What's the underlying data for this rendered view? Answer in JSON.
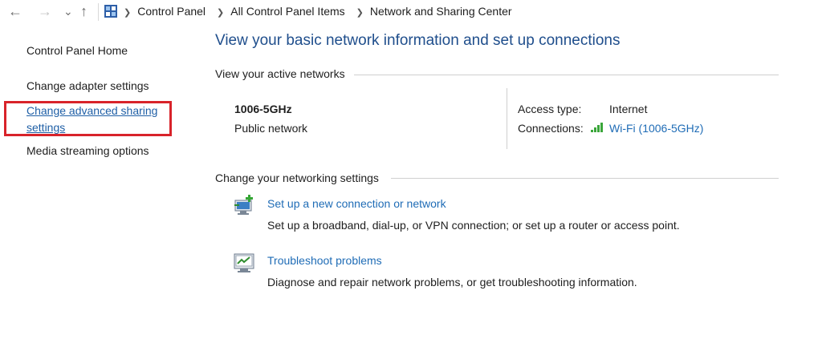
{
  "breadcrumb": [
    "Control Panel",
    "All Control Panel Items",
    "Network and Sharing Center"
  ],
  "nav": {
    "back": "←",
    "forward": "→",
    "recent": "⌄",
    "up": "↑"
  },
  "sidebar": {
    "home": "Control Panel Home",
    "items": [
      "Change adapter settings",
      "Change advanced sharing settings",
      "Media streaming options"
    ]
  },
  "main": {
    "title": "View your basic network information and set up connections",
    "active_networks_header": "View your active networks",
    "network": {
      "name": "1006-5GHz",
      "type": "Public network",
      "access_type_label": "Access type:",
      "access_type_value": "Internet",
      "connections_label": "Connections:",
      "connections_value": "Wi-Fi (1006-5GHz)"
    },
    "networking_settings_header": "Change your networking settings",
    "tasks": [
      {
        "icon": "new-connection-icon",
        "link": "Set up a new connection or network",
        "description": "Set up a broadband, dial-up, or VPN connection; or set up a router or access point."
      },
      {
        "icon": "troubleshoot-icon",
        "link": "Troubleshoot problems",
        "description": "Diagnose and repair network problems, or get troubleshooting information."
      }
    ]
  },
  "colors": {
    "title": "#1f4e8c",
    "link": "#1f6cb6",
    "highlight_box": "#d8232a",
    "wifi_signal": "#3aa63a"
  }
}
